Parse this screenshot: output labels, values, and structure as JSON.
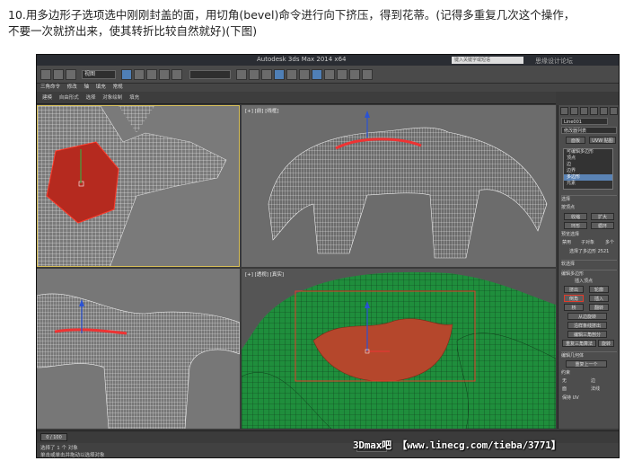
{
  "caption": {
    "line1": "10.用多边形子选项选中刚刚封盖的面，用切角(bevel)命令进行向下挤压，得到花蒂。(记得多重复几次这个操作，",
    "line2": "不要一次就挤出来，使其转折比较自然就好)(下图)"
  },
  "app": {
    "title": "Autodesk 3ds Max 2014 x64",
    "search_placeholder": "键入关键字或短语",
    "selection_dropdown": "视图",
    "snap_dropdown": "",
    "menu": [
      "三角命令",
      "修改",
      "轴",
      "填充",
      "常规"
    ],
    "ribbon": [
      "建模",
      "自由形式",
      "选择",
      "对象绘制",
      "填充"
    ]
  },
  "viewports": {
    "top_right_label": "[+] [前] [线框]",
    "bottom_right_label": "[+] [透视] [真实]",
    "top_left_label": "",
    "bottom_left_label": ""
  },
  "command_panel": {
    "object_name": "Line001",
    "modifier_list": "修改器列表",
    "btn_panel": "面板",
    "btn_uvw": "UVW 贴图",
    "stack": [
      "可编辑多边形",
      "顶点",
      "边",
      "边界",
      "多边形",
      "元素"
    ],
    "stack_selected": 4,
    "selection_header": "选择",
    "soft_select": "按顶点",
    "shrink": "收缩",
    "grow": "扩大",
    "ring": "环形",
    "loop": "循环",
    "preview_label": "预览选择",
    "disable": "禁用",
    "subobject": "子对象",
    "multi": "多个",
    "selected_count": "选择了多边形 2521",
    "soft_header": "软选择",
    "edit_poly_header": "编辑多边形",
    "insert_vertex": "插入顶点",
    "extrude": "挤出",
    "outline": "轮廓",
    "bevel": "倒角",
    "inset": "插入",
    "bridge": "桥",
    "flip": "翻转",
    "hinge": "从边旋转",
    "extrude_spline": "沿样条线挤出",
    "edit_tri": "编辑三角剖分",
    "retri": "重复三角算法",
    "turn": "旋转",
    "edit_geo_header": "编辑几何体",
    "repeat_last": "重复上一个",
    "constraints": "约束",
    "none": "无",
    "edge": "边",
    "face": "面",
    "normal": "法线",
    "preserve_uv": "保持 UV"
  },
  "status": {
    "selected": "选择了 1 个 对象",
    "hint": "单击或单击并拖动以选择对象",
    "frame": "0 / 100",
    "x_value": "335.789m"
  },
  "watermark": {
    "top": "思缘设计论坛 www.missyuan.com",
    "bottom": "3Dmax吧 【www.linecg.com/tieba/3771】"
  }
}
